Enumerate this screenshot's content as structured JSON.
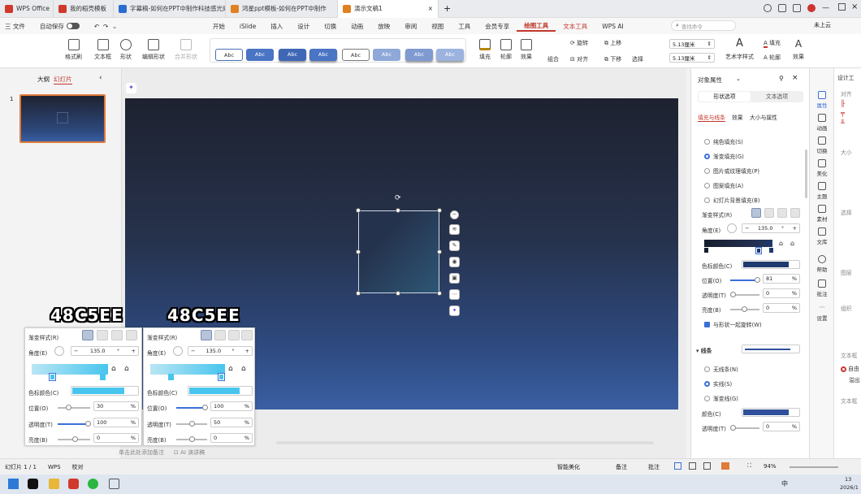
{
  "titlebar": {
    "tabs": [
      {
        "label": "WPS Office",
        "color": "#d0392b",
        "active": false
      },
      {
        "label": "我的稻壳模板",
        "color": "#d0392b",
        "active": false
      },
      {
        "label": "字幕稿-如何在PPT中制作科技感光效",
        "color": "#2b6cd0",
        "active": false
      },
      {
        "label": "鸿星ppt模板-如何在PPT中制作",
        "color": "#e08020",
        "active": false
      },
      {
        "label": "演示文稿1",
        "color": "#e08020",
        "active": true
      }
    ],
    "new_tab": "+",
    "user": "未上云"
  },
  "menubar": {
    "file": "三 文件",
    "autosave": "自动保存",
    "items": [
      "开始",
      "iSlide",
      "插入",
      "设计",
      "切换",
      "动画",
      "放映",
      "审阅",
      "视图",
      "工具",
      "会员专享",
      "绘图工具",
      "文本工具",
      "WPS AI"
    ],
    "selected": "绘图工具",
    "search_placeholder": "查找命令"
  },
  "ribbon": {
    "format_painter": "格式刷",
    "textbox": "文本框",
    "shape": "形状",
    "edit_shape": "编辑形状",
    "merge_shape": "合并形状",
    "style_label": "Abc",
    "fill": "填充",
    "outline": "轮廓",
    "effect": "效果",
    "rotate": "旋转",
    "align": "对齐",
    "up_layer": "上移",
    "down_layer": "下移",
    "group": "组合",
    "select": "选择",
    "height": "5.13厘米",
    "width": "5.13厘米",
    "art_text": "艺术字样式",
    "text_fill": "填充",
    "text_outline": "轮廓",
    "text_effect": "效果"
  },
  "leftpanel": {
    "tab_outline": "大纲",
    "tab_slides": "幻灯片",
    "slide_number": "1"
  },
  "rightpanel": {
    "title": "对象属性",
    "tab_shape": "形状选项",
    "tab_text": "文本选项",
    "subtabs": [
      "填充与线条",
      "效果",
      "大小与属性"
    ],
    "fill_options": [
      "纯色填充(S)",
      "渐变填充(G)",
      "图片或纹理填充(P)",
      "图案填充(A)",
      "幻灯片背景填充(B)"
    ],
    "fill_selected": 1,
    "gradient_style": "渐变样式(R)",
    "angle_label": "角度(E)",
    "angle_value": "135.0",
    "stop_color_label": "色标颜色(C)",
    "stop_color": "#1f3a6e",
    "position_label": "位置(O)",
    "position_value": "81",
    "transparency_label": "透明度(T)",
    "transparency_value": "0",
    "brightness_label": "亮度(B)",
    "brightness_value": "0",
    "rotate_with_shape": "与形状一起旋转(W)",
    "line_section": "线条",
    "line_options": [
      "无线条(N)",
      "实线(S)",
      "渐变线(G)"
    ],
    "line_selected": 1,
    "line_color_label": "颜色(C)",
    "line_color": "#2f4f9a",
    "line_transparency_label": "透明度(T)",
    "line_transparency_value": "0",
    "percent": "%"
  },
  "sidebar": {
    "items": [
      "属性",
      "动画",
      "切换",
      "美化",
      "主题",
      "素材",
      "文库",
      "帮助",
      "批注",
      "设置"
    ]
  },
  "farright": {
    "title": "设计工",
    "labels": [
      "对齐",
      "大小",
      "选择",
      "图层",
      "组织",
      "文本框",
      "自由",
      "溢出",
      "文本框"
    ]
  },
  "overlay_left": {
    "title": "48C5EE",
    "gradient_style": "渐变样式(R)",
    "angle_label": "角度(E)",
    "angle_value": "135.0",
    "stop_color_label": "色标颜色(C)",
    "stop_color": "#48c5ee",
    "position_label": "位置(O)",
    "position_value": "30",
    "transparency_label": "透明度(T)",
    "transparency_value": "100",
    "brightness_label": "亮度(B)",
    "brightness_value": "0",
    "percent": "%"
  },
  "overlay_right": {
    "title": "48C5EE",
    "gradient_style": "渐变样式(R)",
    "angle_label": "角度(E)",
    "angle_value": "135.0",
    "stop_color_label": "色标颜色(C)",
    "stop_color": "#48c5ee",
    "position_label": "位置(O)",
    "position_value": "100",
    "transparency_label": "透明度(T)",
    "transparency_value": "50",
    "brightness_label": "亮度(B)",
    "brightness_value": "0",
    "percent": "%"
  },
  "notes_hint": "单击此处添加备注",
  "ai_notes": "AI 演讲稿",
  "statusbar": {
    "slide_info": "幻灯片 1 / 1",
    "theme": "WPS",
    "proof": "校对",
    "smart_beautify": "智能美化",
    "notes": "备注",
    "comments": "批注",
    "zoom": "94%"
  },
  "taskbar": {
    "ime": "中",
    "time": "13",
    "date": "2026/1"
  }
}
